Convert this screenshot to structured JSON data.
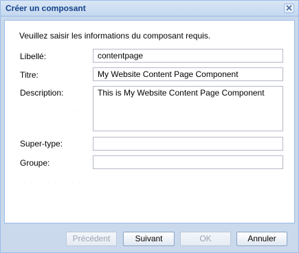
{
  "dialog": {
    "title": "Créer un composant",
    "intro": "Veuillez saisir les informations du composant requis."
  },
  "form": {
    "libelle_label": "Libellé:",
    "libelle_value": "contentpage",
    "titre_label": "Titre:",
    "titre_value": "My Website Content Page Component",
    "description_label": "Description:",
    "description_value": "This is My Website Content Page Component",
    "supertype_label": "Super-type:",
    "supertype_value": "",
    "groupe_label": "Groupe:",
    "groupe_value": ""
  },
  "footer": {
    "previous_label": "Précédent",
    "next_label": "Suivant",
    "ok_label": "OK",
    "cancel_label": "Annuler"
  },
  "icons": {
    "close": "close-icon"
  },
  "colors": {
    "title_text": "#15428b",
    "border": "#99bbe8",
    "frame": "#cad9ec"
  }
}
